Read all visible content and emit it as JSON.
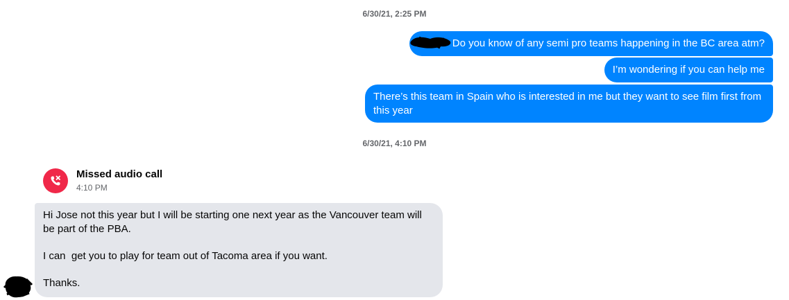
{
  "thread": {
    "timestamp_1": "6/30/21, 2:25 PM",
    "timestamp_2": "6/30/21, 4:10 PM",
    "outgoing": [
      "Do you know of any semi pro teams happening in the BC area atm?",
      "I’m wondering if you can help me",
      "There’s this team in Spain who is interested in me but they want to see film first from this year"
    ],
    "missed_call": {
      "title": "Missed audio call",
      "time": "4:10 PM",
      "icon": "missed-call-icon"
    },
    "incoming": {
      "para1": "Hi Jose not this year but I will be starting one next year as the Vancouver team will be part of the PBA.",
      "para2": "I can  get you to play for team out of Tacoma area if you want.",
      "para3": "Thanks."
    },
    "colors": {
      "outgoing_bubble": "#0084ff",
      "incoming_bubble": "#e4e6eb",
      "missed_call": "#f02849",
      "timestamp": "#65676b"
    }
  }
}
